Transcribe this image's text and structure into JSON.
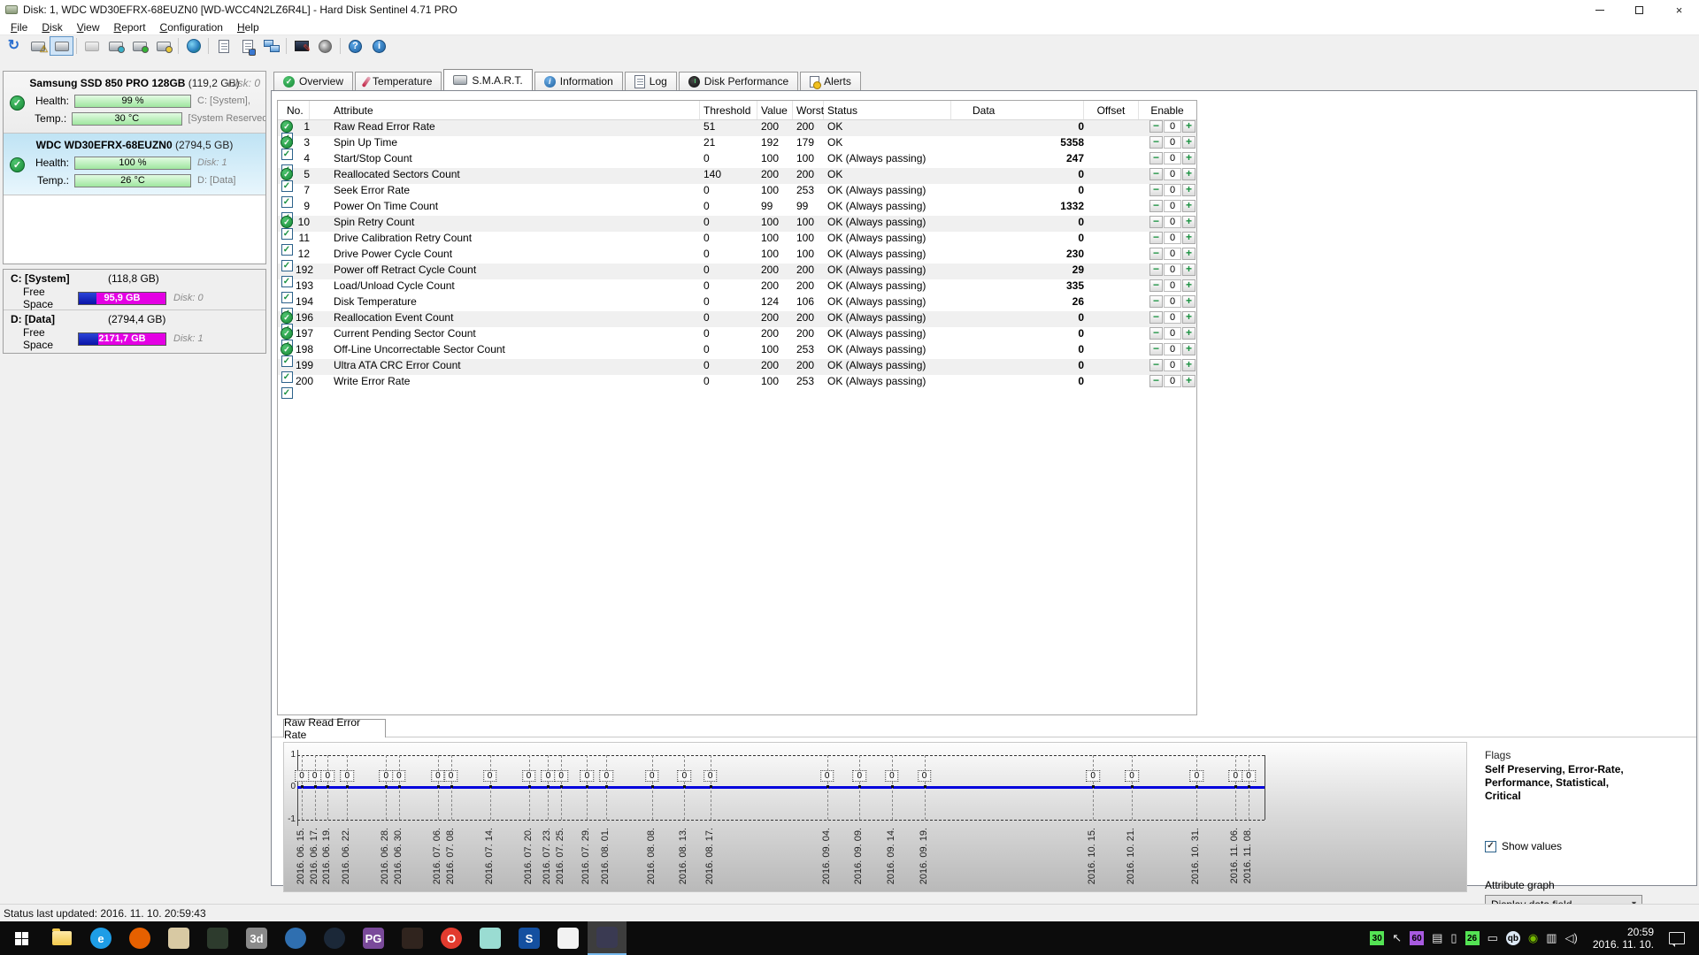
{
  "window": {
    "title": "Disk: 1, WDC WD30EFRX-68EUZN0 [WD-WCC4N2LZ6R4L]  -  Hard Disk Sentinel 4.71 PRO"
  },
  "menu": [
    {
      "label": "File",
      "u": 0
    },
    {
      "label": "Disk",
      "u": 0
    },
    {
      "label": "View",
      "u": 0
    },
    {
      "label": "Report",
      "u": 0
    },
    {
      "label": "Configuration",
      "u": 0
    },
    {
      "label": "Help",
      "u": 0
    }
  ],
  "toolbar": [
    {
      "name": "refresh-button",
      "icon": "refresh"
    },
    {
      "name": "disk-warning-button",
      "icon": "disk",
      "badge": "warn"
    },
    {
      "name": "disk-view-button",
      "icon": "disk",
      "framed": true
    },
    {
      "sep": true
    },
    {
      "name": "disk-disabled-button",
      "icon": "disk",
      "disabled": true
    },
    {
      "name": "disk-surface-test-button",
      "icon": "disk",
      "badge": "#3ab0c8"
    },
    {
      "name": "disk-selftest-button",
      "icon": "disk",
      "badge": "#35b335"
    },
    {
      "name": "disk-analyse-button",
      "icon": "disk",
      "badge": "#e8c83a"
    },
    {
      "sep": true
    },
    {
      "name": "online-update-button",
      "icon": "globe"
    },
    {
      "sep": true
    },
    {
      "name": "report-button",
      "icon": "page"
    },
    {
      "name": "export-report-button",
      "icon": "page",
      "badge": "#3a78d0"
    },
    {
      "name": "network-status-button",
      "icon": "network"
    },
    {
      "sep": true
    },
    {
      "name": "settings-button",
      "icon": "monitor-pen"
    },
    {
      "name": "sound-settings-button",
      "icon": "speaker"
    },
    {
      "sep": true
    },
    {
      "name": "help-button",
      "icon": "qmark",
      "glyph": "?"
    },
    {
      "name": "info-button",
      "icon": "qmark",
      "glyph": "i"
    }
  ],
  "sidebar": {
    "disks": [
      {
        "title": "Samsung SSD 850 PRO 128GB",
        "size": "(119,2 GB)",
        "top_right": "Disk: 0",
        "selected": false,
        "rows": [
          {
            "label": "Health:",
            "bar": "99 %",
            "right": "C: [System],",
            "italic": false
          },
          {
            "label": "Temp.:",
            "bar": "30 °C",
            "right": "[System Reserved]",
            "italic": false
          }
        ]
      },
      {
        "title": "WDC WD30EFRX-68EUZN0",
        "size": "(2794,5 GB)",
        "top_right": "",
        "selected": true,
        "rows": [
          {
            "label": "Health:",
            "bar": "100 %",
            "right": "Disk: 1",
            "italic": true
          },
          {
            "label": "Temp.:",
            "bar": "26 °C",
            "right": "D: [Data]",
            "italic": false
          }
        ]
      }
    ],
    "partitions": [
      {
        "name": "C: [System]",
        "size": "(118,8 GB)",
        "free_label": "Free Space",
        "free": "95,9 GB",
        "used_pct": 20,
        "disk": "Disk: 0"
      },
      {
        "name": "D: [Data]",
        "size": "(2794,4 GB)",
        "free_label": "Free Space",
        "free": "2171,7 GB",
        "used_pct": 22,
        "disk": "Disk: 1"
      }
    ]
  },
  "tabs": [
    {
      "label": "Overview",
      "name": "tab-overview",
      "icon": "check",
      "active": false
    },
    {
      "label": "Temperature",
      "name": "tab-temperature",
      "icon": "thermo",
      "active": false
    },
    {
      "label": "S.M.A.R.T.",
      "name": "tab-smart",
      "icon": "disk",
      "active": true
    },
    {
      "label": "Information",
      "name": "tab-information",
      "icon": "info",
      "active": false
    },
    {
      "label": "Log",
      "name": "tab-log",
      "icon": "page",
      "active": false
    },
    {
      "label": "Disk Performance",
      "name": "tab-disk-performance",
      "icon": "gauge",
      "active": false
    },
    {
      "label": "Alerts",
      "name": "tab-alerts",
      "icon": "alert",
      "active": false
    }
  ],
  "smart": {
    "columns": [
      "No.",
      "Attribute",
      "Threshold",
      "Value",
      "Worst",
      "Status",
      "Data",
      "Offset",
      "Enable"
    ],
    "rows": [
      {
        "check": true,
        "no": "1",
        "attribute": "Raw Read Error Rate",
        "threshold": "51",
        "value": "200",
        "worst": "200",
        "status": "OK",
        "data": "0",
        "offset": "0",
        "enabled": true
      },
      {
        "check": true,
        "no": "3",
        "attribute": "Spin Up Time",
        "threshold": "21",
        "value": "192",
        "worst": "179",
        "status": "OK",
        "data": "5358",
        "offset": "0",
        "enabled": true
      },
      {
        "check": false,
        "no": "4",
        "attribute": "Start/Stop Count",
        "threshold": "0",
        "value": "100",
        "worst": "100",
        "status": "OK (Always passing)",
        "data": "247",
        "offset": "0",
        "enabled": true
      },
      {
        "check": true,
        "no": "5",
        "attribute": "Reallocated Sectors Count",
        "threshold": "140",
        "value": "200",
        "worst": "200",
        "status": "OK",
        "data": "0",
        "offset": "0",
        "enabled": true
      },
      {
        "check": false,
        "no": "7",
        "attribute": "Seek Error Rate",
        "threshold": "0",
        "value": "100",
        "worst": "253",
        "status": "OK (Always passing)",
        "data": "0",
        "offset": "0",
        "enabled": true
      },
      {
        "check": false,
        "no": "9",
        "attribute": "Power On Time Count",
        "threshold": "0",
        "value": "99",
        "worst": "99",
        "status": "OK (Always passing)",
        "data": "1332",
        "offset": "0",
        "enabled": true
      },
      {
        "check": true,
        "no": "10",
        "attribute": "Spin Retry Count",
        "threshold": "0",
        "value": "100",
        "worst": "100",
        "status": "OK (Always passing)",
        "data": "0",
        "offset": "0",
        "enabled": true
      },
      {
        "check": false,
        "no": "11",
        "attribute": "Drive Calibration Retry Count",
        "threshold": "0",
        "value": "100",
        "worst": "100",
        "status": "OK (Always passing)",
        "data": "0",
        "offset": "0",
        "enabled": true
      },
      {
        "check": false,
        "no": "12",
        "attribute": "Drive Power Cycle Count",
        "threshold": "0",
        "value": "100",
        "worst": "100",
        "status": "OK (Always passing)",
        "data": "230",
        "offset": "0",
        "enabled": true
      },
      {
        "check": false,
        "no": "192",
        "attribute": "Power off Retract Cycle Count",
        "threshold": "0",
        "value": "200",
        "worst": "200",
        "status": "OK (Always passing)",
        "data": "29",
        "offset": "0",
        "enabled": true
      },
      {
        "check": false,
        "no": "193",
        "attribute": "Load/Unload Cycle Count",
        "threshold": "0",
        "value": "200",
        "worst": "200",
        "status": "OK (Always passing)",
        "data": "335",
        "offset": "0",
        "enabled": true
      },
      {
        "check": false,
        "no": "194",
        "attribute": "Disk Temperature",
        "threshold": "0",
        "value": "124",
        "worst": "106",
        "status": "OK (Always passing)",
        "data": "26",
        "offset": "0",
        "enabled": true
      },
      {
        "check": true,
        "no": "196",
        "attribute": "Reallocation Event Count",
        "threshold": "0",
        "value": "200",
        "worst": "200",
        "status": "OK (Always passing)",
        "data": "0",
        "offset": "0",
        "enabled": true
      },
      {
        "check": true,
        "no": "197",
        "attribute": "Current Pending Sector Count",
        "threshold": "0",
        "value": "200",
        "worst": "200",
        "status": "OK (Always passing)",
        "data": "0",
        "offset": "0",
        "enabled": true
      },
      {
        "check": true,
        "no": "198",
        "attribute": "Off-Line Uncorrectable Sector Count",
        "threshold": "0",
        "value": "100",
        "worst": "253",
        "status": "OK (Always passing)",
        "data": "0",
        "offset": "0",
        "enabled": true
      },
      {
        "check": false,
        "no": "199",
        "attribute": "Ultra ATA CRC Error Count",
        "threshold": "0",
        "value": "200",
        "worst": "200",
        "status": "OK (Always passing)",
        "data": "0",
        "offset": "0",
        "enabled": true
      },
      {
        "check": false,
        "no": "200",
        "attribute": "Write Error Rate",
        "threshold": "0",
        "value": "100",
        "worst": "253",
        "status": "OK (Always passing)",
        "data": "0",
        "offset": "0",
        "enabled": true
      }
    ]
  },
  "graph": {
    "tab": "Raw Read Error Rate",
    "y_ticks": [
      "1",
      "0",
      "-1"
    ],
    "flags_label": "Flags",
    "flags_value": "Self Preserving, Error-Rate, Performance, Statistical, Critical",
    "show_values_label": "Show values",
    "show_values_checked": true,
    "attribute_graph_label": "Attribute graph",
    "attribute_graph_value": "Display data field"
  },
  "chart_data": {
    "type": "line",
    "title": "Raw Read Error Rate",
    "x": [
      "2016. 06. 15.",
      "2016. 06. 17.",
      "2016. 06. 19.",
      "2016. 06. 22.",
      "2016. 06. 28.",
      "2016. 06. 30.",
      "2016. 07. 06.",
      "2016. 07. 08.",
      "2016. 07. 14.",
      "2016. 07. 20.",
      "2016. 07. 23.",
      "2016. 07. 25.",
      "2016. 07. 29.",
      "2016. 08. 01.",
      "2016. 08. 08.",
      "2016. 08. 13.",
      "2016. 08. 17.",
      "2016. 09. 04.",
      "2016. 09. 09.",
      "2016. 09. 14.",
      "2016. 09. 19.",
      "2016. 10. 15.",
      "2016. 10. 21.",
      "2016. 10. 31.",
      "2016. 11. 06.",
      "2016. 11. 08."
    ],
    "values": [
      0,
      0,
      0,
      0,
      0,
      0,
      0,
      0,
      0,
      0,
      0,
      0,
      0,
      0,
      0,
      0,
      0,
      0,
      0,
      0,
      0,
      0,
      0,
      0,
      0,
      0
    ],
    "ylim": [
      -1,
      1
    ],
    "line_color": "#0000dd",
    "grid": "vertical-dashed",
    "point_labels_shown": true
  },
  "statusbar": {
    "text": "Status last updated: 2016. 11. 10. 20:59:43"
  },
  "taskbar": {
    "apps": [
      {
        "name": "taskbar-file-explorer",
        "style": "folder",
        "bg": "",
        "text": ""
      },
      {
        "name": "taskbar-edge",
        "style": "circle",
        "bg": "#1e9de6",
        "text": "e"
      },
      {
        "name": "taskbar-firefox",
        "style": "circle",
        "bg": "#e66000",
        "text": ""
      },
      {
        "name": "taskbar-file-manager",
        "style": "square",
        "bg": "#d8c9a3",
        "text": ""
      },
      {
        "name": "taskbar-security-app",
        "style": "square",
        "bg": "#2d3b2d",
        "text": ""
      },
      {
        "name": "taskbar-3d-app",
        "style": "square",
        "bg": "#8a8a8a",
        "text": "3d"
      },
      {
        "name": "taskbar-database-app",
        "style": "circle",
        "bg": "#2f6fb0",
        "text": ""
      },
      {
        "name": "taskbar-steam",
        "style": "circle",
        "bg": "#1b2838",
        "text": ""
      },
      {
        "name": "taskbar-png-app",
        "style": "square",
        "bg": "#7a4a9a",
        "text": "PG"
      },
      {
        "name": "taskbar-dark-app",
        "style": "square",
        "bg": "#30241e",
        "text": ""
      },
      {
        "name": "taskbar-opera",
        "style": "circle",
        "bg": "#e23b2e",
        "text": "O"
      },
      {
        "name": "taskbar-media-app",
        "style": "square",
        "bg": "#9adcd2",
        "text": ""
      },
      {
        "name": "taskbar-blue-app",
        "style": "square",
        "bg": "#1450a0",
        "text": "S"
      },
      {
        "name": "taskbar-notes-app",
        "style": "square",
        "bg": "#f2f2f2",
        "text": ""
      },
      {
        "name": "taskbar-image-editor",
        "style": "square",
        "bg": "#3a3a52",
        "text": "",
        "active": true
      }
    ],
    "tray": [
      {
        "name": "tray-hdsentinel-temp-1",
        "style": "badge",
        "bg": "#54e354",
        "text": "30"
      },
      {
        "name": "tray-cursor-icon",
        "style": "glyph",
        "text": "↖"
      },
      {
        "name": "tray-display-60hz-icon",
        "style": "badge",
        "bg": "#a85ae0",
        "text": "60"
      },
      {
        "name": "tray-input-device-icon",
        "style": "glyph",
        "text": "▤"
      },
      {
        "name": "tray-usb-icon",
        "style": "glyph",
        "text": "▯"
      },
      {
        "name": "tray-hdsentinel-temp-2",
        "style": "badge",
        "bg": "#54e354",
        "text": "26"
      },
      {
        "name": "tray-monitor-icon",
        "style": "glyph",
        "text": "▭"
      },
      {
        "name": "tray-qbittorrent-icon",
        "style": "badge",
        "bg": "#dce8f4",
        "text": "qb"
      },
      {
        "name": "tray-nvidia-icon",
        "style": "glyph",
        "text": "◉",
        "color": "#76b900"
      },
      {
        "name": "tray-network-icon",
        "style": "glyph",
        "text": "▥"
      },
      {
        "name": "tray-volume-icon",
        "style": "glyph",
        "text": "◁)"
      }
    ],
    "clock_time": "20:59",
    "clock_date": "2016. 11. 10."
  }
}
